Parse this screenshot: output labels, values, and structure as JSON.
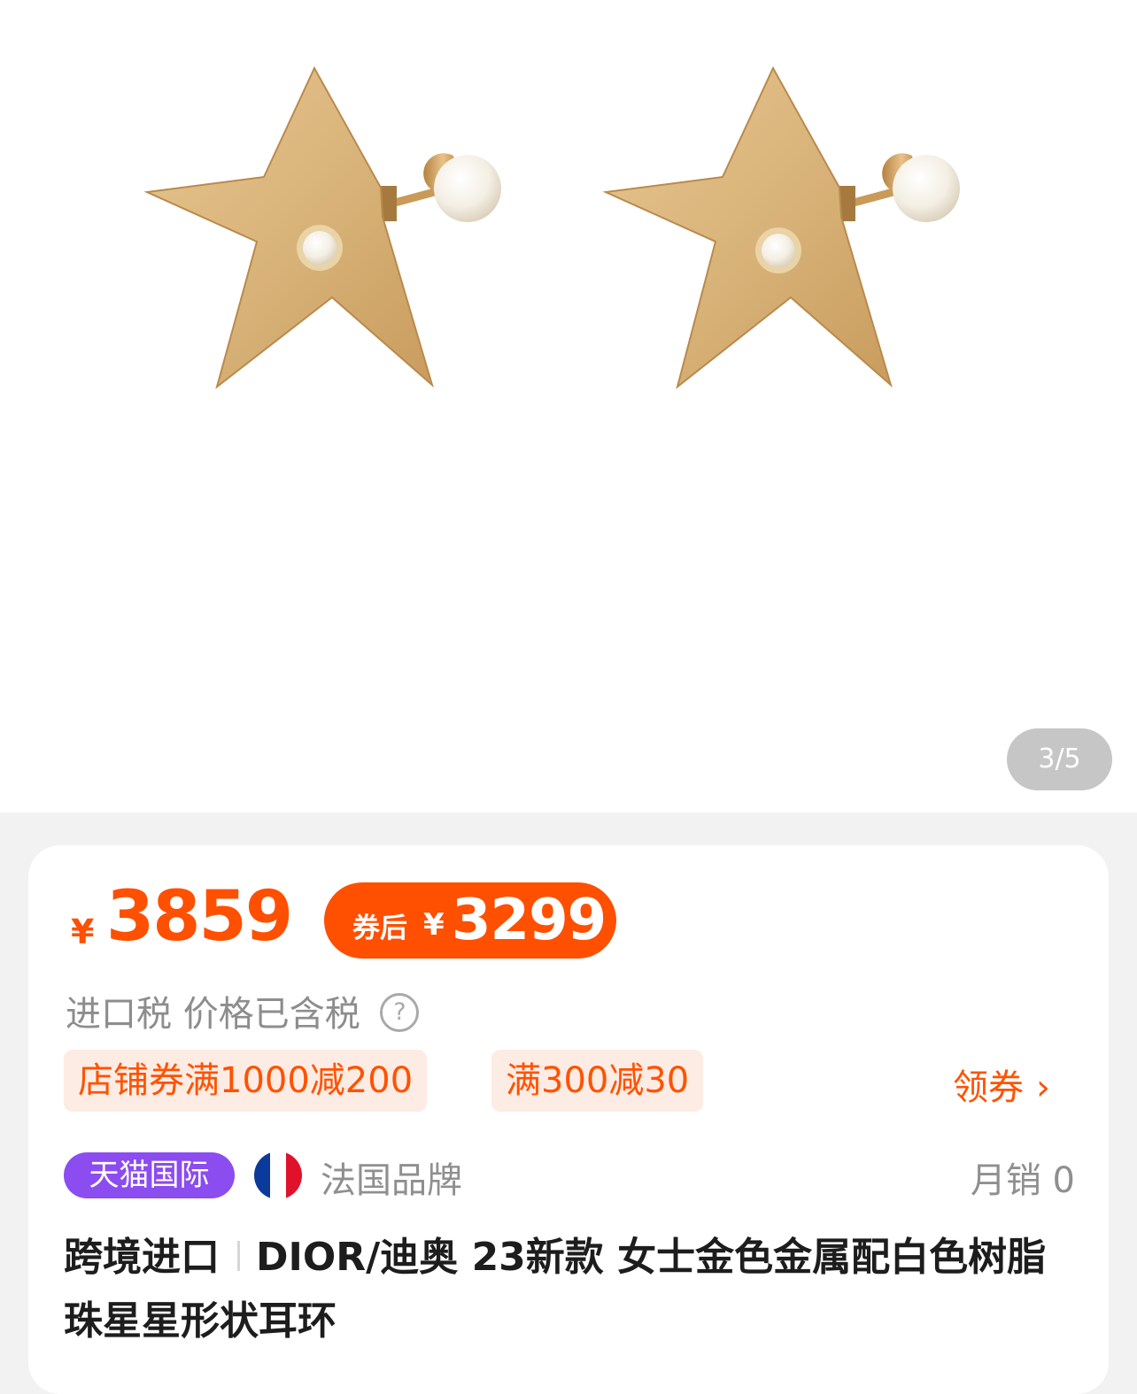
{
  "gallery": {
    "image_alt": "pair of gold star-shaped earrings with white pearls",
    "page_indicator": "3/5"
  },
  "price": {
    "currency": "¥",
    "value": "3859",
    "after_coupon_label": "券后",
    "after_coupon_currency": "¥",
    "after_coupon_value": "3299"
  },
  "tax": {
    "text": "进口税 价格已含税",
    "help_symbol": "?"
  },
  "coupons": {
    "items": [
      "店铺券满1000减200",
      "满300减30"
    ],
    "get_label": "领券",
    "chevron": "›"
  },
  "badges": {
    "platform": "天猫国际",
    "flag_colors": [
      "#0b3a9b",
      "#ffffff",
      "#e0112b"
    ],
    "origin": "法国品牌",
    "monthly_sales": "月销 0"
  },
  "product": {
    "tag": "跨境进口",
    "title": "DIOR/迪奥 23新款 女士金色金属配白色树脂珠星星形状耳环"
  },
  "colors": {
    "accent": "#ff4f00",
    "tmall_purple": "#8b4cf0",
    "coupon_bg": "#fdece4"
  }
}
